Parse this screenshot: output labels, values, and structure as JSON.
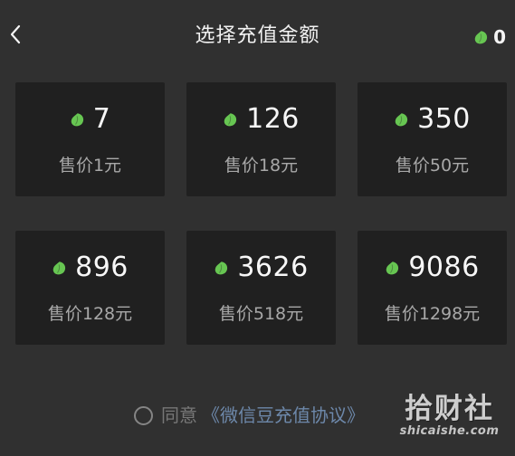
{
  "header": {
    "title": "选择充值金额",
    "back_icon": "chevron-left-icon",
    "balance": "0",
    "balance_icon": "green-bean-icon"
  },
  "recharge_options": [
    {
      "amount": "7",
      "price": "售价1元"
    },
    {
      "amount": "126",
      "price": "售价18元"
    },
    {
      "amount": "350",
      "price": "售价50元"
    },
    {
      "amount": "896",
      "price": "售价128元"
    },
    {
      "amount": "3626",
      "price": "售价518元"
    },
    {
      "amount": "9086",
      "price": "售价1298元"
    }
  ],
  "agreement": {
    "checked": false,
    "prefix": "同意",
    "link_text": "《微信豆充值协议》"
  },
  "watermark": {
    "logo": "拾财社",
    "url": "shicaishe.com"
  },
  "colors": {
    "background": "#303030",
    "card": "#202020",
    "bean_green": "#67c652",
    "primary_text": "#f7f7f7",
    "secondary_text": "#a8a8a8",
    "link": "#6d88aa"
  }
}
